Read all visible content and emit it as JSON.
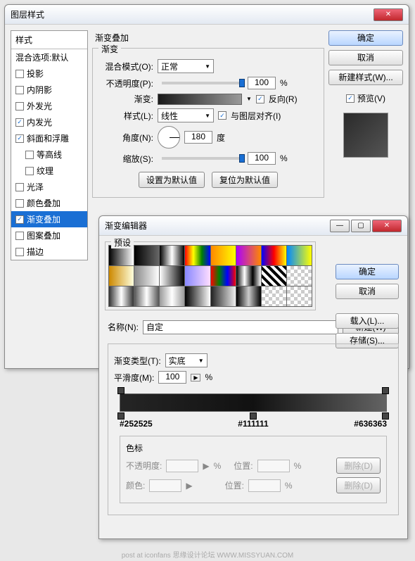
{
  "layerStyle": {
    "title": "图层样式",
    "stylesHeader": "样式",
    "blendOptions": "混合选项:默认",
    "items": [
      {
        "label": "投影",
        "checked": false
      },
      {
        "label": "内阴影",
        "checked": false
      },
      {
        "label": "外发光",
        "checked": false
      },
      {
        "label": "内发光",
        "checked": true
      },
      {
        "label": "斜面和浮雕",
        "checked": true
      },
      {
        "label": "等高线",
        "checked": false,
        "sub": true
      },
      {
        "label": "纹理",
        "checked": false,
        "sub": true
      },
      {
        "label": "光泽",
        "checked": false
      },
      {
        "label": "颜色叠加",
        "checked": false
      },
      {
        "label": "渐变叠加",
        "checked": true,
        "selected": true
      },
      {
        "label": "图案叠加",
        "checked": false
      },
      {
        "label": "描边",
        "checked": false
      }
    ],
    "panelTitle": "渐变叠加",
    "gradientGroup": "渐变",
    "blendModeLabel": "混合模式(O):",
    "blendModeValue": "正常",
    "opacityLabel": "不透明度(P):",
    "opacityValue": "100",
    "pct": "%",
    "gradientLabel": "渐变:",
    "reverseLabel": "反向(R)",
    "styleLabel": "样式(L):",
    "styleValue": "线性",
    "alignLabel": "与图层对齐(I)",
    "angleLabel": "角度(N):",
    "angleValue": "180",
    "angleUnit": "度",
    "scaleLabel": "缩放(S):",
    "scaleValue": "100",
    "setDefault": "设置为默认值",
    "resetDefault": "复位为默认值",
    "ok": "确定",
    "cancel": "取消",
    "newStyle": "新建样式(W)...",
    "previewLabel": "预览(V)"
  },
  "gradEditor": {
    "title": "渐变编辑器",
    "presetsLabel": "预设",
    "ok": "确定",
    "cancel": "取消",
    "load": "载入(L)...",
    "save": "存储(S)...",
    "nameLabel": "名称(N):",
    "nameValue": "自定",
    "newBtn": "新建(W)",
    "gradTypeLabel": "渐变类型(T):",
    "gradTypeValue": "实底",
    "smoothLabel": "平滑度(M):",
    "smoothValue": "100",
    "pct": "%",
    "hex1": "#252525",
    "hex2": "#111111",
    "hex3": "#636363",
    "stopsLabel": "色标",
    "stopOpacity": "不透明度:",
    "stopPos": "位置:",
    "stopColor": "颜色:",
    "delete": "删除(D)"
  },
  "footer": "post at iconfans  思缘设计论坛  WWW.MISSYUAN.COM"
}
